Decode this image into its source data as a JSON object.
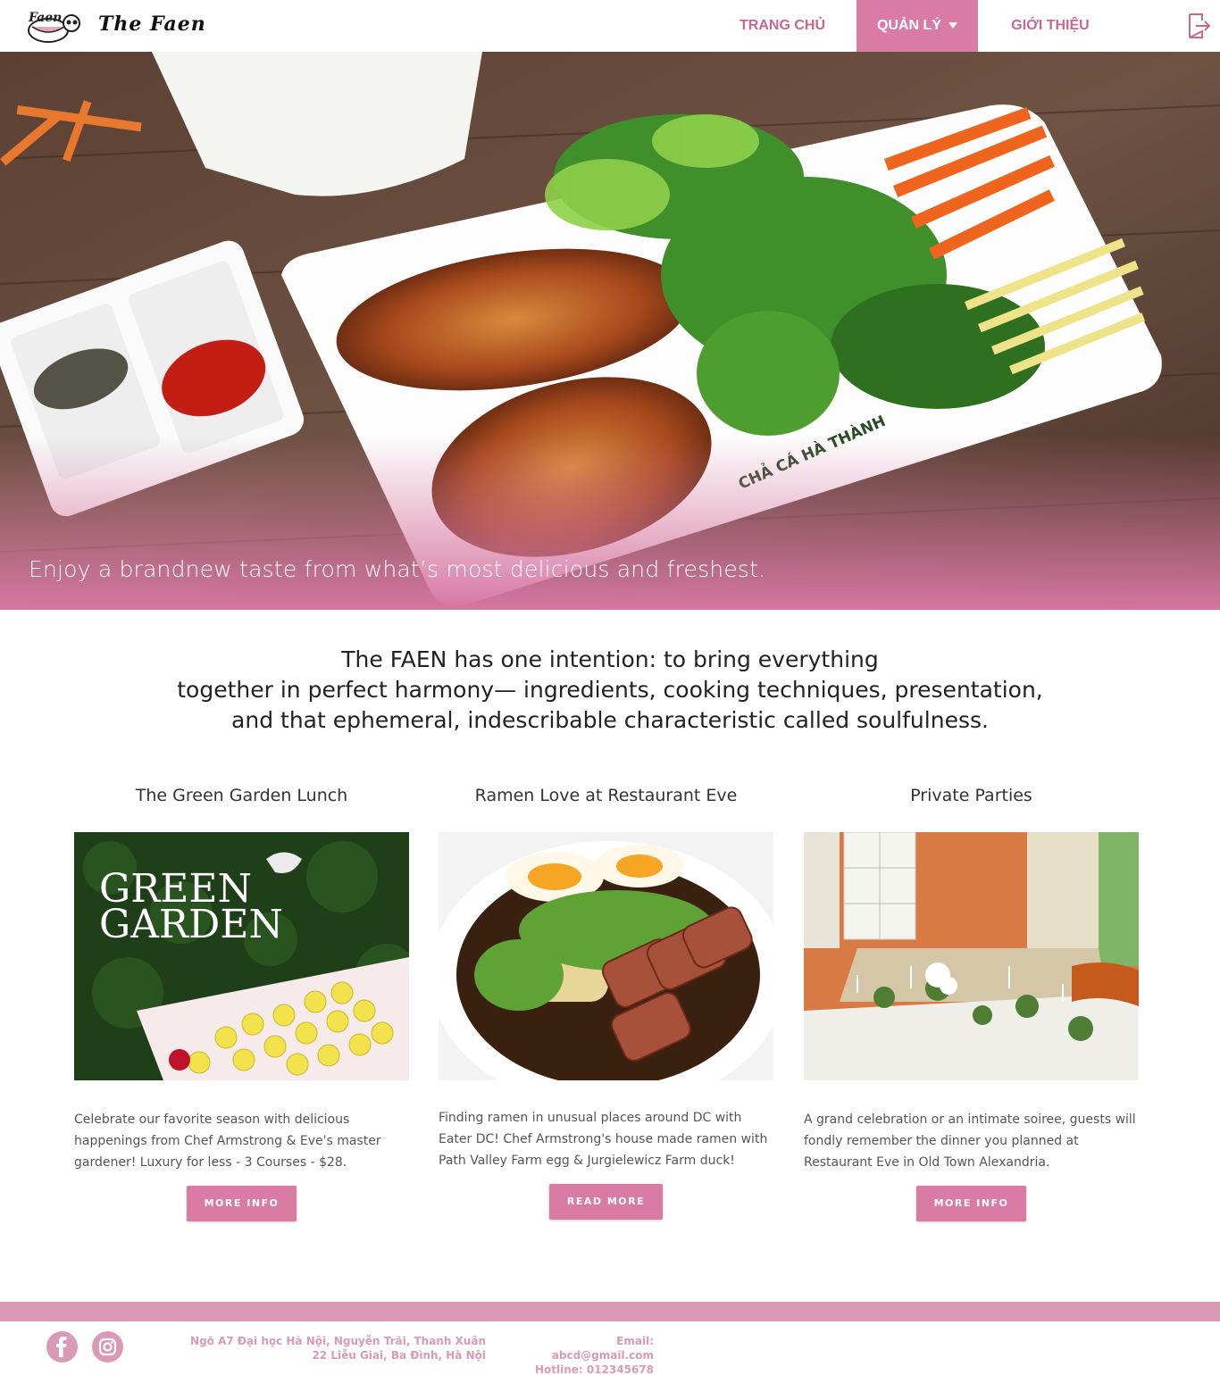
{
  "header": {
    "brand": "The Faen",
    "logo_text": "Faen",
    "nav": [
      {
        "label": "TRANG CHỦ"
      },
      {
        "label": "QUẢN LÝ"
      },
      {
        "label": "GIỚI THIỆU"
      }
    ]
  },
  "hero": {
    "caption": "Enjoy a brandnew taste from what’s most delicious and freshest.",
    "plate_text": "CHẢ CÁ HÀ THÀNH"
  },
  "intro": {
    "lines": [
      "The FAEN has one intention: to bring everything",
      "together in perfect harmony— ingredients, cooking techniques, presentation,",
      "and that ephemeral, indescribable characteristic called soulfulness."
    ]
  },
  "cards": [
    {
      "title": "The Green Garden Lunch",
      "image_text": [
        "GREEN",
        "GARDEN"
      ],
      "text": "Celebrate our favorite season with delicious happenings from Chef Armstrong & Eve's master gardener! Luxury for less - 3 Courses - $28.",
      "button": "MORE INFO"
    },
    {
      "title": "Ramen Love at Restaurant Eve",
      "text": "Finding ramen in unusual places around DC with Eater DC! Chef Armstrong's house made ramen with Path Valley Farm egg & Jurgielewicz Farm duck!",
      "button": "READ MORE"
    },
    {
      "title": "Private Parties",
      "text": "A grand celebration or an intimate soiree, guests will fondly remember the dinner you planned at Restaurant Eve in Old Town Alexandria.",
      "button": "MORE INFO"
    }
  ],
  "footer": {
    "address_lines": [
      "Ngõ A7 Đại học Hà Nội, Nguyễn Trãi, Thanh Xuân",
      "22 Liễu Giai, Ba Đình, Hà Nội"
    ],
    "email": "Email: abcd@gmail.com",
    "hotline": "Hotline: 012345678",
    "social": [
      "facebook-icon",
      "instagram-icon"
    ]
  },
  "colors": {
    "accent": "#d97ba3",
    "accent_light": "#d99ab8",
    "nav_text": "#c8678f"
  }
}
